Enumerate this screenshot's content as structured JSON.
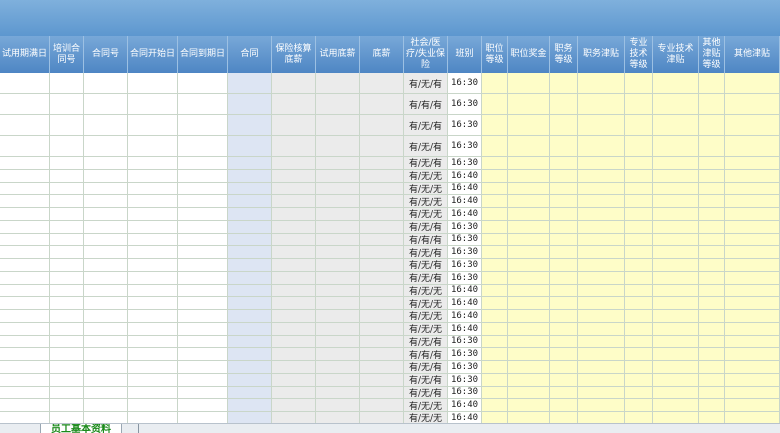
{
  "colors": {
    "header_bg": "#5d97cf",
    "header_text": "#ffffff",
    "blue_col": "#dde5f3",
    "gray_col": "#ebebeb",
    "yellow_col": "#fefdc8",
    "sheet_tab_text": "#1b8a1b"
  },
  "header": {
    "columns": [
      "试用期满日",
      "培训合同号",
      "合同号",
      "合同开始日",
      "合同到期日",
      "合同",
      "保险核算底薪",
      "试用底薪",
      "底薪",
      "社会/医疗/失业保险",
      "班别",
      "职位等级",
      "职位奖金",
      "职务等级",
      "职务津贴",
      "专业技术等级",
      "专业技术津贴",
      "其他津贴等级",
      "其他津贴"
    ]
  },
  "rows": [
    {
      "insurance": "有/无/有",
      "shift": "16:30"
    },
    {
      "insurance": "有/有/有",
      "shift": "16:30"
    },
    {
      "insurance": "有/无/有",
      "shift": "16:30"
    },
    {
      "insurance": "有/无/有",
      "shift": "16:30"
    },
    {
      "insurance": "有/无/有",
      "shift": "16:30"
    },
    {
      "insurance": "有/无/无",
      "shift": "16:40"
    },
    {
      "insurance": "有/无/无",
      "shift": "16:40"
    },
    {
      "insurance": "有/无/无",
      "shift": "16:40"
    },
    {
      "insurance": "有/无/无",
      "shift": "16:40"
    },
    {
      "insurance": "有/无/有",
      "shift": "16:30"
    },
    {
      "insurance": "有/有/有",
      "shift": "16:30"
    },
    {
      "insurance": "有/无/有",
      "shift": "16:30"
    },
    {
      "insurance": "有/无/有",
      "shift": "16:30"
    },
    {
      "insurance": "有/无/有",
      "shift": "16:30"
    },
    {
      "insurance": "有/无/无",
      "shift": "16:40"
    },
    {
      "insurance": "有/无/无",
      "shift": "16:40"
    },
    {
      "insurance": "有/无/无",
      "shift": "16:40"
    },
    {
      "insurance": "有/无/无",
      "shift": "16:40"
    },
    {
      "insurance": "有/无/有",
      "shift": "16:30"
    },
    {
      "insurance": "有/有/有",
      "shift": "16:30"
    },
    {
      "insurance": "有/无/有",
      "shift": "16:30"
    },
    {
      "insurance": "有/无/有",
      "shift": "16:30"
    },
    {
      "insurance": "有/无/有",
      "shift": "16:30"
    },
    {
      "insurance": "有/无/无",
      "shift": "16:40"
    },
    {
      "insurance": "有/无/无",
      "shift": "16:40"
    }
  ],
  "sheet_tabs": {
    "active": "员工基本资料"
  }
}
